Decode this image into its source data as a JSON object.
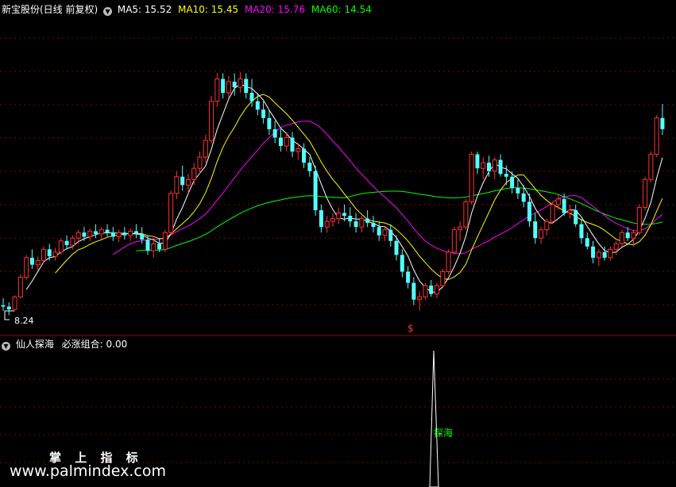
{
  "main_panel": {
    "stock_title": "新宝股份(日线 前复权)",
    "ma_labels": [
      {
        "text": "MA5: 15.52",
        "color": "#ffffff"
      },
      {
        "text": "MA10: 15.45",
        "color": "#ffff00"
      },
      {
        "text": "MA20: 15.76",
        "color": "#ff00ff"
      },
      {
        "text": "MA60: 14.54",
        "color": "#00ff00"
      }
    ],
    "low_marker": "8.24",
    "signal_glyph": "$"
  },
  "indicator_panel": {
    "title": "仙人探海",
    "value_label": "必涨组合: 0.00",
    "signal_text": "探海"
  },
  "watermark": {
    "line1": "掌 上 指 标",
    "line2": "www.palmindex.com"
  },
  "colors": {
    "up": "#ff3232",
    "down": "#54ffff",
    "grid": "#800000",
    "ma5": "#ffffff",
    "ma10": "#ffff00",
    "ma20": "#ff00ff",
    "ma60": "#00ff00",
    "signal": "#00ff00"
  },
  "chart_data": {
    "type": "line",
    "price_range": [
      7.6,
      18.9
    ],
    "candles": [
      [
        8.6,
        8.85,
        8.4,
        8.55
      ],
      [
        8.55,
        8.7,
        8.24,
        8.45
      ],
      [
        8.45,
        8.95,
        8.4,
        8.9
      ],
      [
        8.9,
        9.7,
        8.85,
        9.6
      ],
      [
        9.6,
        10.4,
        9.5,
        10.3
      ],
      [
        10.3,
        10.6,
        9.9,
        10.05
      ],
      [
        10.05,
        10.35,
        9.85,
        10.2
      ],
      [
        10.2,
        10.7,
        10.1,
        10.6
      ],
      [
        10.6,
        10.8,
        10.2,
        10.35
      ],
      [
        10.35,
        10.65,
        10.2,
        10.5
      ],
      [
        10.5,
        11.0,
        10.4,
        10.9
      ],
      [
        10.9,
        11.1,
        10.6,
        10.75
      ],
      [
        10.75,
        11.1,
        10.6,
        11.0
      ],
      [
        11.0,
        11.3,
        10.8,
        11.2
      ],
      [
        11.2,
        11.4,
        10.9,
        11.05
      ],
      [
        11.05,
        11.35,
        10.9,
        11.25
      ],
      [
        11.25,
        11.5,
        11.0,
        11.15
      ],
      [
        11.15,
        11.4,
        10.95,
        11.3
      ],
      [
        11.3,
        11.5,
        11.05,
        11.2
      ],
      [
        11.2,
        11.4,
        10.9,
        11.05
      ],
      [
        11.05,
        11.3,
        10.85,
        11.2
      ],
      [
        11.2,
        11.4,
        10.95,
        11.1
      ],
      [
        11.1,
        11.35,
        10.9,
        11.25
      ],
      [
        11.25,
        11.5,
        11.0,
        11.15
      ],
      [
        11.15,
        11.4,
        10.8,
        10.95
      ],
      [
        10.95,
        11.1,
        10.4,
        10.55
      ],
      [
        10.55,
        10.9,
        10.3,
        10.8
      ],
      [
        10.8,
        11.0,
        10.5,
        10.6
      ],
      [
        10.6,
        11.3,
        10.5,
        11.2
      ],
      [
        11.2,
        12.7,
        11.1,
        12.6
      ],
      [
        12.6,
        13.4,
        12.4,
        13.2
      ],
      [
        13.2,
        13.6,
        12.7,
        12.9
      ],
      [
        12.9,
        13.3,
        12.6,
        13.1
      ],
      [
        13.1,
        13.7,
        12.9,
        13.5
      ],
      [
        13.5,
        14.1,
        13.3,
        13.9
      ],
      [
        13.9,
        14.7,
        13.7,
        14.5
      ],
      [
        14.5,
        16.1,
        14.4,
        15.9
      ],
      [
        15.9,
        16.9,
        15.7,
        16.7
      ],
      [
        16.7,
        16.9,
        16.0,
        16.2
      ],
      [
        16.2,
        16.8,
        16.0,
        16.6
      ],
      [
        16.6,
        16.9,
        16.1,
        16.4
      ],
      [
        16.4,
        16.95,
        16.2,
        16.7
      ],
      [
        16.7,
        16.9,
        16.0,
        16.2
      ],
      [
        16.2,
        16.7,
        15.7,
        15.9
      ],
      [
        15.9,
        16.2,
        15.4,
        15.6
      ],
      [
        15.6,
        15.9,
        15.1,
        15.3
      ],
      [
        15.3,
        15.6,
        14.7,
        14.9
      ],
      [
        14.9,
        15.2,
        14.4,
        14.6
      ],
      [
        14.6,
        14.9,
        14.1,
        14.3
      ],
      [
        14.3,
        14.8,
        14.1,
        14.6
      ],
      [
        14.6,
        14.8,
        13.9,
        14.1
      ],
      [
        14.1,
        14.4,
        13.8,
        14.2
      ],
      [
        14.2,
        14.4,
        13.5,
        13.7
      ],
      [
        13.7,
        13.9,
        13.2,
        13.4
      ],
      [
        13.4,
        13.6,
        11.8,
        12.0
      ],
      [
        12.0,
        12.2,
        11.2,
        11.4
      ],
      [
        11.4,
        11.8,
        11.2,
        11.6
      ],
      [
        11.6,
        11.9,
        11.4,
        11.7
      ],
      [
        11.7,
        12.1,
        11.5,
        11.9
      ],
      [
        11.9,
        12.2,
        11.6,
        11.8
      ],
      [
        11.8,
        12.1,
        11.4,
        11.6
      ],
      [
        11.6,
        11.9,
        11.2,
        11.4
      ],
      [
        11.4,
        11.8,
        11.2,
        11.7
      ],
      [
        11.7,
        12.0,
        11.4,
        11.55
      ],
      [
        11.55,
        11.8,
        11.2,
        11.4
      ],
      [
        11.4,
        11.6,
        10.9,
        11.1
      ],
      [
        11.1,
        11.4,
        10.9,
        11.3
      ],
      [
        11.3,
        11.5,
        10.7,
        10.9
      ],
      [
        10.9,
        11.1,
        10.2,
        10.4
      ],
      [
        10.4,
        10.6,
        9.6,
        9.8
      ],
      [
        9.8,
        10.0,
        9.2,
        9.4
      ],
      [
        9.4,
        9.6,
        8.6,
        8.8
      ],
      [
        8.8,
        9.1,
        8.4,
        8.9
      ],
      [
        8.9,
        9.4,
        8.8,
        9.3
      ],
      [
        9.3,
        9.5,
        8.9,
        9.0
      ],
      [
        9.0,
        9.4,
        8.85,
        9.3
      ],
      [
        9.3,
        9.9,
        9.2,
        9.8
      ],
      [
        9.8,
        10.6,
        9.7,
        10.5
      ],
      [
        10.5,
        11.4,
        10.4,
        11.3
      ],
      [
        11.3,
        11.6,
        10.9,
        11.4
      ],
      [
        11.4,
        12.4,
        11.3,
        12.3
      ],
      [
        12.3,
        14.1,
        12.2,
        14.0
      ],
      [
        14.0,
        14.1,
        13.3,
        13.5
      ],
      [
        13.5,
        13.9,
        13.1,
        13.7
      ],
      [
        13.7,
        13.95,
        13.2,
        13.4
      ],
      [
        13.4,
        13.9,
        13.1,
        13.8
      ],
      [
        13.8,
        14.0,
        13.2,
        13.3
      ],
      [
        13.3,
        13.6,
        12.9,
        13.2
      ],
      [
        13.2,
        13.4,
        12.6,
        12.8
      ],
      [
        12.8,
        13.1,
        12.4,
        12.6
      ],
      [
        12.6,
        12.9,
        12.1,
        12.3
      ],
      [
        12.3,
        12.6,
        11.4,
        11.6
      ],
      [
        11.6,
        11.9,
        10.8,
        11.0
      ],
      [
        11.0,
        11.4,
        10.8,
        11.3
      ],
      [
        11.3,
        11.7,
        11.1,
        11.6
      ],
      [
        11.6,
        12.3,
        11.5,
        12.2
      ],
      [
        12.2,
        12.6,
        12.0,
        12.4
      ],
      [
        12.4,
        12.6,
        11.8,
        11.9
      ],
      [
        11.9,
        12.2,
        11.7,
        12.0
      ],
      [
        12.0,
        12.2,
        11.4,
        11.5
      ],
      [
        11.5,
        11.7,
        10.8,
        11.0
      ],
      [
        11.0,
        11.2,
        10.6,
        10.7
      ],
      [
        10.7,
        10.9,
        10.1,
        10.3
      ],
      [
        10.3,
        10.6,
        10.0,
        10.5
      ],
      [
        10.5,
        10.7,
        10.2,
        10.3
      ],
      [
        10.3,
        10.7,
        10.2,
        10.6
      ],
      [
        10.6,
        10.9,
        10.4,
        10.8
      ],
      [
        10.8,
        11.3,
        10.7,
        11.2
      ],
      [
        11.2,
        11.4,
        10.9,
        11.0
      ],
      [
        11.0,
        11.3,
        10.7,
        11.2
      ],
      [
        11.2,
        12.2,
        11.1,
        12.1
      ],
      [
        12.1,
        13.2,
        12.0,
        13.1
      ],
      [
        13.1,
        14.1,
        13.0,
        14.0
      ],
      [
        14.0,
        15.4,
        13.9,
        15.3
      ],
      [
        15.3,
        15.8,
        14.7,
        14.9
      ]
    ]
  }
}
